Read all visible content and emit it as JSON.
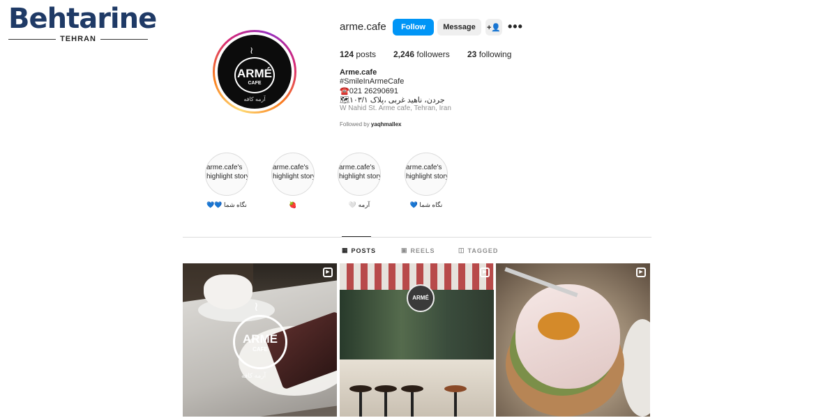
{
  "watermark": {
    "brand": "Behtarine",
    "city": "TEHRAN"
  },
  "profile": {
    "username": "arme.cafe",
    "follow_label": "Follow",
    "message_label": "Message",
    "add_label": "+👤",
    "more_label": "•••",
    "avatar": {
      "logo_word": "ARMÉ",
      "logo_sub": "CAFE",
      "logo_fa": "آرمه کافه"
    }
  },
  "stats": {
    "posts_count": "124",
    "posts_label": " posts",
    "followers_count": "2,246",
    "followers_label": " followers",
    "following_count": "23",
    "following_label": " following"
  },
  "bio": {
    "name": "Arme.cafe",
    "hashtag": "#SmileInArmeCafe",
    "phone": "☎️021 26290691",
    "address_fa": "🗺جردن، ناهید غربی ،پلاک ۱۰۳/۱",
    "address_en": "W Nahid St. Arme cafe, Tehran, Iran",
    "followed_prefix": "Followed by ",
    "followed_user": "yaqhmallex"
  },
  "highlights": [
    {
      "alt": "arme.cafe's highlight story",
      "label": "💙💙 نگاه شما"
    },
    {
      "alt": "arme.cafe's highlight story",
      "label": "🍓"
    },
    {
      "alt": "arme.cafe's highlight story",
      "label": "🤍 آرمه"
    },
    {
      "alt": "arme.cafe's highlight story",
      "label": "💙 نگاه شما"
    }
  ],
  "tabs": {
    "posts": {
      "icon": "▦",
      "label": "POSTS"
    },
    "reels": {
      "icon": "▣",
      "label": "REELS"
    },
    "tagged": {
      "icon": "◫",
      "label": "TAGGED"
    }
  },
  "posts": [
    {
      "logo_word": "ARMÉ",
      "logo_sub": "CAFE",
      "logo_fa": "آرمه کافه",
      "reel_icon": "▶"
    },
    {
      "sign": "ARMÉ",
      "reel_icon": "▶"
    },
    {
      "reel_icon": "▶"
    }
  ]
}
